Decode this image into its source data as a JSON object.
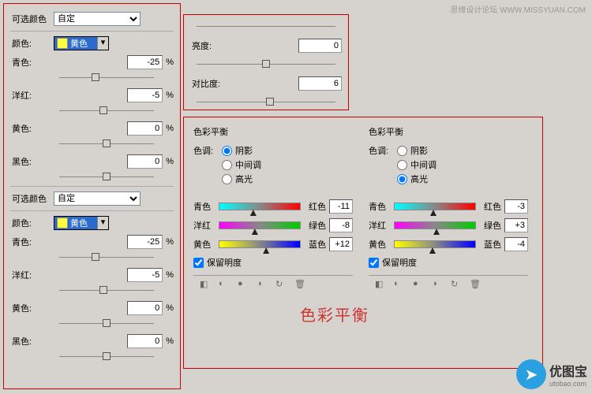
{
  "watermark": "思缘设计论坛  WWW.MISSYUAN.COM",
  "selective_color": {
    "title": "可选颜色",
    "preset": "自定",
    "color_lbl": "颜色:",
    "color_swatch": "黄色",
    "cyan": {
      "label": "青色:",
      "value": "-25"
    },
    "magenta": {
      "label": "洋红:",
      "value": "-5"
    },
    "yellow": {
      "label": "黄色:",
      "value": "0"
    },
    "black": {
      "label": "黑色:",
      "value": "0"
    },
    "pct": "%"
  },
  "brightness_contrast": {
    "brightness": {
      "label": "亮度:",
      "value": "0"
    },
    "contrast": {
      "label": "对比度:",
      "value": "6"
    }
  },
  "color_balance": {
    "title": "色彩平衡",
    "tone_lbl": "色调:",
    "shadows": "阴影",
    "midtones": "中间调",
    "highlights": "高光",
    "cyan": "青色",
    "red": "红色",
    "magenta": "洋红",
    "green": "绿色",
    "yellow": "黄色",
    "blue": "蓝色",
    "preserve": "保留明度",
    "left": {
      "selected": "shadows",
      "cr": "-11",
      "mg": "-8",
      "yb": "+12"
    },
    "right": {
      "selected": "highlights",
      "cr": "-3",
      "mg": "+3",
      "yb": "-4"
    }
  },
  "overlay": "色彩平衡",
  "logo": {
    "name": "优图宝",
    "url": "utobao.com"
  }
}
